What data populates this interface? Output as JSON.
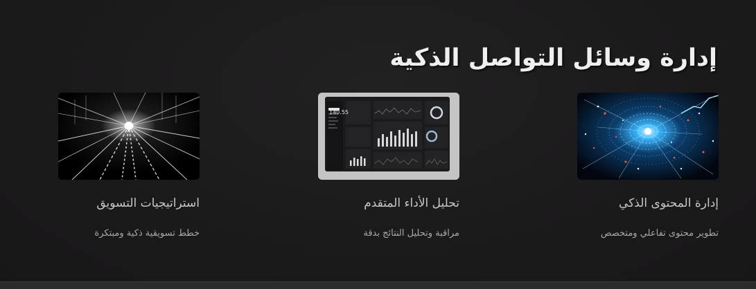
{
  "section": {
    "title": "إدارة وسائل التواصل الذكية"
  },
  "cards": [
    {
      "title": "إدارة المحتوى الذكي",
      "description": "تطوير محتوى تفاعلي ومتخصص",
      "image": "ai-network-visual"
    },
    {
      "title": "تحليل الأداء المتقدم",
      "description": "مراقبة وتحليل النتائج بدقة",
      "image": "analytics-dashboard-screenshot",
      "dashboard_value": "140.55"
    },
    {
      "title": "استراتيجيات التسويق",
      "description": "خطط تسويقية ذكية ومبتكرة",
      "image": "light-speed-tunnel-visual"
    }
  ],
  "colors": {
    "background": "#1b1a1b",
    "title": "#efefef",
    "card_title": "#c8c8c8",
    "card_desc": "#a9a9a9",
    "network_accent": "#39b7ff"
  }
}
